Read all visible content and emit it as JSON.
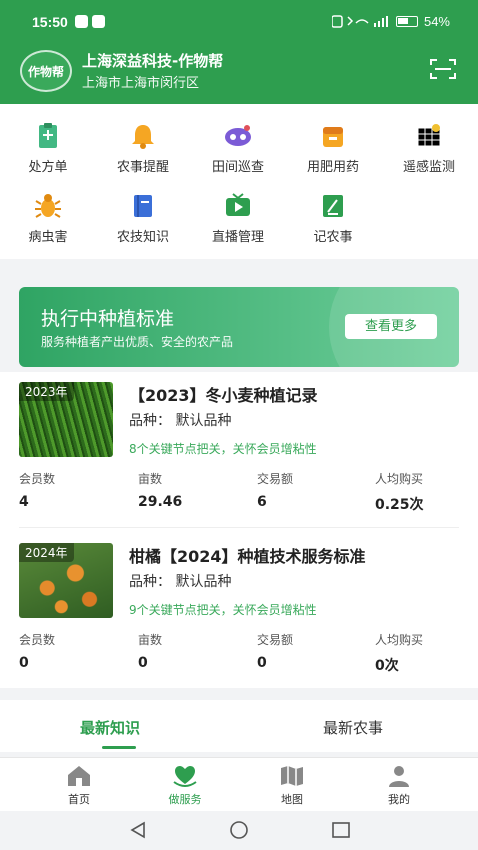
{
  "status_bar": {
    "time": "15:50",
    "battery": "54%"
  },
  "header": {
    "logo_text": "作物帮",
    "title": "上海深益科技-作物帮",
    "location": "上海市上海市闵行区"
  },
  "quick_menu": [
    {
      "label": "处方单",
      "icon": "prescription-icon"
    },
    {
      "label": "农事提醒",
      "icon": "bell-icon"
    },
    {
      "label": "田间巡查",
      "icon": "patrol-icon"
    },
    {
      "label": "用肥用药",
      "icon": "fertilizer-icon"
    },
    {
      "label": "遥感监测",
      "icon": "remote-sensing-icon"
    },
    {
      "label": "病虫害",
      "icon": "pest-icon"
    },
    {
      "label": "农技知识",
      "icon": "book-icon"
    },
    {
      "label": "直播管理",
      "icon": "live-icon"
    },
    {
      "label": "记农事",
      "icon": "notes-icon"
    }
  ],
  "banner": {
    "title": "执行中种植标准",
    "subtitle": "服务种植者产出优质、安全的农产品",
    "more_label": "查看更多"
  },
  "records": [
    {
      "year_tag": "2023年",
      "title": "【2023】冬小麦种植记录",
      "variety": "品种：  默认品种",
      "note": "8个关键节点把关，关怀会员增粘性",
      "stats": [
        {
          "label": "会员数",
          "value": "4"
        },
        {
          "label": "亩数",
          "value": "29.46"
        },
        {
          "label": "交易额",
          "value": "6"
        },
        {
          "label": "人均购买",
          "value": "0.25次"
        }
      ]
    },
    {
      "year_tag": "2024年",
      "title": "柑橘【2024】种植技术服务标准",
      "variety": "品种：  默认品种",
      "note": "9个关键节点把关，关怀会员增粘性",
      "stats": [
        {
          "label": "会员数",
          "value": "0"
        },
        {
          "label": "亩数",
          "value": "0"
        },
        {
          "label": "交易额",
          "value": "0"
        },
        {
          "label": "人均购买",
          "value": "0次"
        }
      ]
    }
  ],
  "tabs": [
    {
      "label": "最新知识",
      "active": true
    },
    {
      "label": "最新农事",
      "active": false
    }
  ],
  "bottom_nav": [
    {
      "label": "首页",
      "icon": "home-icon",
      "active": false
    },
    {
      "label": "做服务",
      "icon": "service-icon",
      "active": true
    },
    {
      "label": "地图",
      "icon": "map-icon",
      "active": false
    },
    {
      "label": "我的",
      "icon": "profile-icon",
      "active": false
    }
  ],
  "colors": {
    "brand": "#2e9e4f",
    "accent_text": "#3aa95b"
  }
}
